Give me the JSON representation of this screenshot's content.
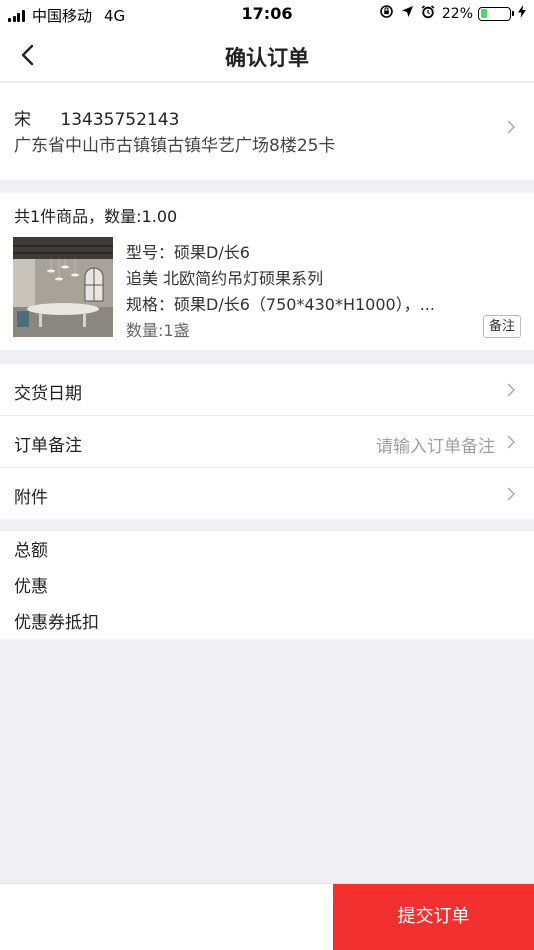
{
  "status_bar": {
    "carrier": "中国移动",
    "network": "4G",
    "time": "17:06",
    "battery_percent": "22%",
    "battery_level": 0.22,
    "icons": [
      "signal-icon",
      "rotation-lock-icon",
      "location-arrow-icon",
      "alarm-icon",
      "battery-icon",
      "charging-bolt-icon"
    ]
  },
  "nav": {
    "title": "确认订单",
    "back_icon": "chevron-left-icon"
  },
  "address": {
    "name": "宋",
    "phone": "13435752143",
    "detail": "广东省中山市古镇镇古镇华艺广场8楼25卡"
  },
  "product": {
    "summary": "共1件商品，数量:1.00",
    "model": "型号：硕果D/长6",
    "name": "追美 北欧简约吊灯硕果系列",
    "spec": "规格：硕果D/长6（750*430*H1000），...",
    "quantity": "数量:1盏",
    "remark_button": "备注"
  },
  "options": {
    "delivery_date_label": "交货日期",
    "order_note_label": "订单备注",
    "order_note_placeholder": "请输入订单备注",
    "attachment_label": "附件"
  },
  "totals": {
    "total_label": "总额",
    "discount_label": "优惠",
    "coupon_label": "优惠券抵扣"
  },
  "footer": {
    "submit_label": "提交订单"
  },
  "colors": {
    "accent": "#f23030",
    "background": "#efeff4",
    "battery": "#4cd964"
  }
}
